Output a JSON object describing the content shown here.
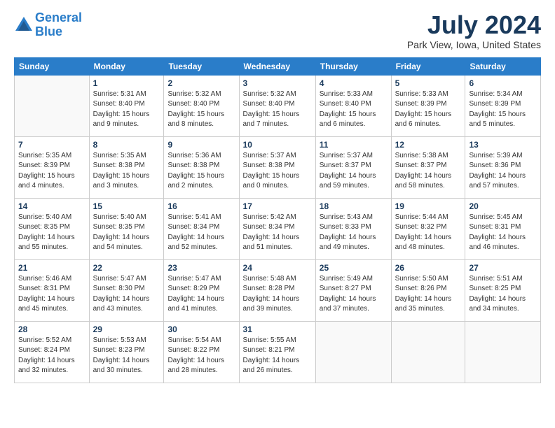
{
  "header": {
    "logo_line1": "General",
    "logo_line2": "Blue",
    "month_title": "July 2024",
    "location": "Park View, Iowa, United States"
  },
  "weekdays": [
    "Sunday",
    "Monday",
    "Tuesday",
    "Wednesday",
    "Thursday",
    "Friday",
    "Saturday"
  ],
  "weeks": [
    [
      {
        "day": "",
        "info": ""
      },
      {
        "day": "1",
        "info": "Sunrise: 5:31 AM\nSunset: 8:40 PM\nDaylight: 15 hours\nand 9 minutes."
      },
      {
        "day": "2",
        "info": "Sunrise: 5:32 AM\nSunset: 8:40 PM\nDaylight: 15 hours\nand 8 minutes."
      },
      {
        "day": "3",
        "info": "Sunrise: 5:32 AM\nSunset: 8:40 PM\nDaylight: 15 hours\nand 7 minutes."
      },
      {
        "day": "4",
        "info": "Sunrise: 5:33 AM\nSunset: 8:40 PM\nDaylight: 15 hours\nand 6 minutes."
      },
      {
        "day": "5",
        "info": "Sunrise: 5:33 AM\nSunset: 8:39 PM\nDaylight: 15 hours\nand 6 minutes."
      },
      {
        "day": "6",
        "info": "Sunrise: 5:34 AM\nSunset: 8:39 PM\nDaylight: 15 hours\nand 5 minutes."
      }
    ],
    [
      {
        "day": "7",
        "info": "Sunrise: 5:35 AM\nSunset: 8:39 PM\nDaylight: 15 hours\nand 4 minutes."
      },
      {
        "day": "8",
        "info": "Sunrise: 5:35 AM\nSunset: 8:38 PM\nDaylight: 15 hours\nand 3 minutes."
      },
      {
        "day": "9",
        "info": "Sunrise: 5:36 AM\nSunset: 8:38 PM\nDaylight: 15 hours\nand 2 minutes."
      },
      {
        "day": "10",
        "info": "Sunrise: 5:37 AM\nSunset: 8:38 PM\nDaylight: 15 hours\nand 0 minutes."
      },
      {
        "day": "11",
        "info": "Sunrise: 5:37 AM\nSunset: 8:37 PM\nDaylight: 14 hours\nand 59 minutes."
      },
      {
        "day": "12",
        "info": "Sunrise: 5:38 AM\nSunset: 8:37 PM\nDaylight: 14 hours\nand 58 minutes."
      },
      {
        "day": "13",
        "info": "Sunrise: 5:39 AM\nSunset: 8:36 PM\nDaylight: 14 hours\nand 57 minutes."
      }
    ],
    [
      {
        "day": "14",
        "info": "Sunrise: 5:40 AM\nSunset: 8:35 PM\nDaylight: 14 hours\nand 55 minutes."
      },
      {
        "day": "15",
        "info": "Sunrise: 5:40 AM\nSunset: 8:35 PM\nDaylight: 14 hours\nand 54 minutes."
      },
      {
        "day": "16",
        "info": "Sunrise: 5:41 AM\nSunset: 8:34 PM\nDaylight: 14 hours\nand 52 minutes."
      },
      {
        "day": "17",
        "info": "Sunrise: 5:42 AM\nSunset: 8:34 PM\nDaylight: 14 hours\nand 51 minutes."
      },
      {
        "day": "18",
        "info": "Sunrise: 5:43 AM\nSunset: 8:33 PM\nDaylight: 14 hours\nand 49 minutes."
      },
      {
        "day": "19",
        "info": "Sunrise: 5:44 AM\nSunset: 8:32 PM\nDaylight: 14 hours\nand 48 minutes."
      },
      {
        "day": "20",
        "info": "Sunrise: 5:45 AM\nSunset: 8:31 PM\nDaylight: 14 hours\nand 46 minutes."
      }
    ],
    [
      {
        "day": "21",
        "info": "Sunrise: 5:46 AM\nSunset: 8:31 PM\nDaylight: 14 hours\nand 45 minutes."
      },
      {
        "day": "22",
        "info": "Sunrise: 5:47 AM\nSunset: 8:30 PM\nDaylight: 14 hours\nand 43 minutes."
      },
      {
        "day": "23",
        "info": "Sunrise: 5:47 AM\nSunset: 8:29 PM\nDaylight: 14 hours\nand 41 minutes."
      },
      {
        "day": "24",
        "info": "Sunrise: 5:48 AM\nSunset: 8:28 PM\nDaylight: 14 hours\nand 39 minutes."
      },
      {
        "day": "25",
        "info": "Sunrise: 5:49 AM\nSunset: 8:27 PM\nDaylight: 14 hours\nand 37 minutes."
      },
      {
        "day": "26",
        "info": "Sunrise: 5:50 AM\nSunset: 8:26 PM\nDaylight: 14 hours\nand 35 minutes."
      },
      {
        "day": "27",
        "info": "Sunrise: 5:51 AM\nSunset: 8:25 PM\nDaylight: 14 hours\nand 34 minutes."
      }
    ],
    [
      {
        "day": "28",
        "info": "Sunrise: 5:52 AM\nSunset: 8:24 PM\nDaylight: 14 hours\nand 32 minutes."
      },
      {
        "day": "29",
        "info": "Sunrise: 5:53 AM\nSunset: 8:23 PM\nDaylight: 14 hours\nand 30 minutes."
      },
      {
        "day": "30",
        "info": "Sunrise: 5:54 AM\nSunset: 8:22 PM\nDaylight: 14 hours\nand 28 minutes."
      },
      {
        "day": "31",
        "info": "Sunrise: 5:55 AM\nSunset: 8:21 PM\nDaylight: 14 hours\nand 26 minutes."
      },
      {
        "day": "",
        "info": ""
      },
      {
        "day": "",
        "info": ""
      },
      {
        "day": "",
        "info": ""
      }
    ]
  ]
}
